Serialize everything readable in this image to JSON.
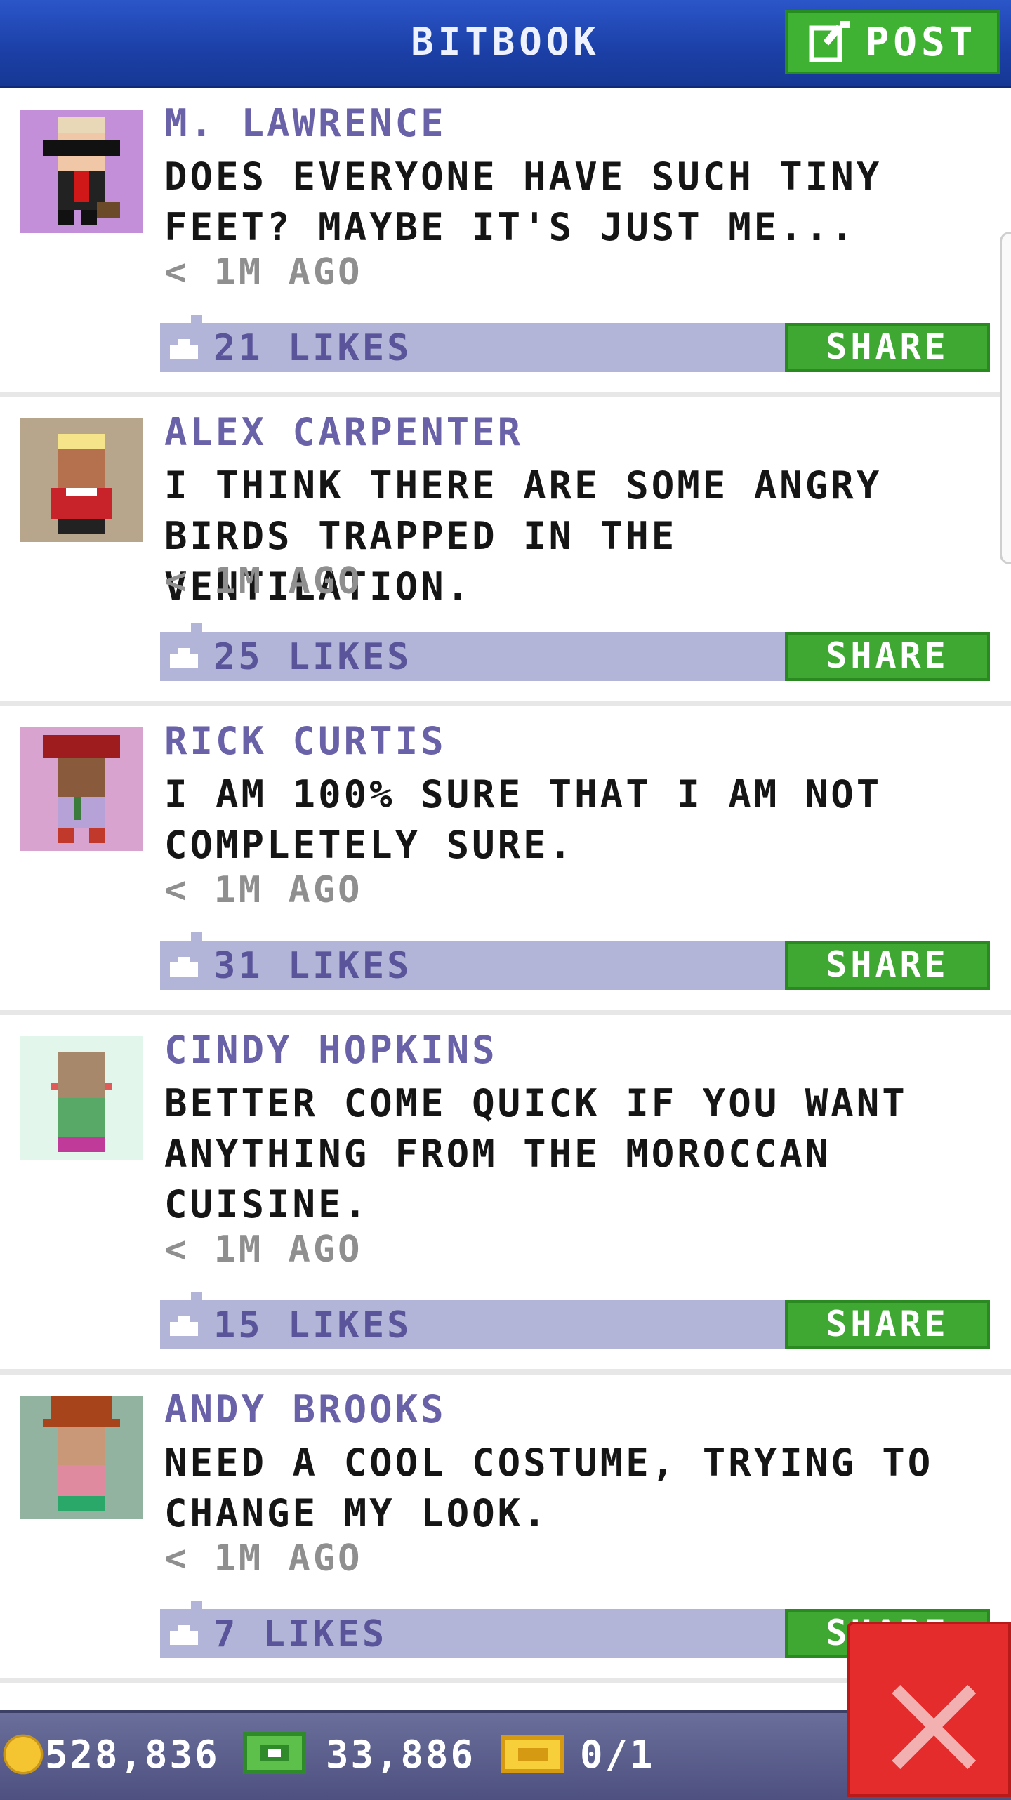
{
  "header": {
    "title": "BITBOOK",
    "post_label": "POST"
  },
  "posts": [
    {
      "author": "M. LAWRENCE",
      "message": "DOES EVERYONE HAVE SUCH TINY FEET? MAYBE IT'S JUST ME...",
      "time": "< 1M AGO",
      "likes": "21 LIKES",
      "share": "SHARE",
      "avatar_bg": "#c28fd8"
    },
    {
      "author": "ALEX CARPENTER",
      "message": "I THINK THERE ARE SOME ANGRY BIRDS TRAPPED IN THE VENTILATION.",
      "time": "< 1M AGO",
      "likes": "25 LIKES",
      "share": "SHARE",
      "avatar_bg": "#b7a58c"
    },
    {
      "author": "RICK CURTIS",
      "message": "I AM 100% SURE THAT I AM NOT COMPLETELY SURE.",
      "time": "< 1M AGO",
      "likes": "31 LIKES",
      "share": "SHARE",
      "avatar_bg": "#d9a3cf"
    },
    {
      "author": "CINDY HOPKINS",
      "message": "BETTER COME QUICK IF YOU WANT ANYTHING FROM THE MOROCCAN CUISINE.",
      "time": "< 1M AGO",
      "likes": "15 LIKES",
      "share": "SHARE",
      "avatar_bg": "#e3f6ec"
    },
    {
      "author": "ANDY BROOKS",
      "message": "NEED A COOL COSTUME, TRYING TO CHANGE MY LOOK.",
      "time": "< 1M AGO",
      "likes": "7 LIKES",
      "share": "SHARE",
      "avatar_bg": "#93b3a1"
    }
  ],
  "status": {
    "coins": "528,836",
    "bux": "33,886",
    "tickets": "0/1"
  },
  "colors": {
    "header": "#1b3fa6",
    "accent_green": "#3fa832",
    "like_bar": "#b3b5d8",
    "close_red": "#e52c2c"
  },
  "icons": {
    "post": "edit-icon",
    "like": "thumbs-up-icon",
    "coin": "coin-icon",
    "bux": "bux-icon",
    "ticket": "ticket-icon",
    "close": "close-icon"
  }
}
